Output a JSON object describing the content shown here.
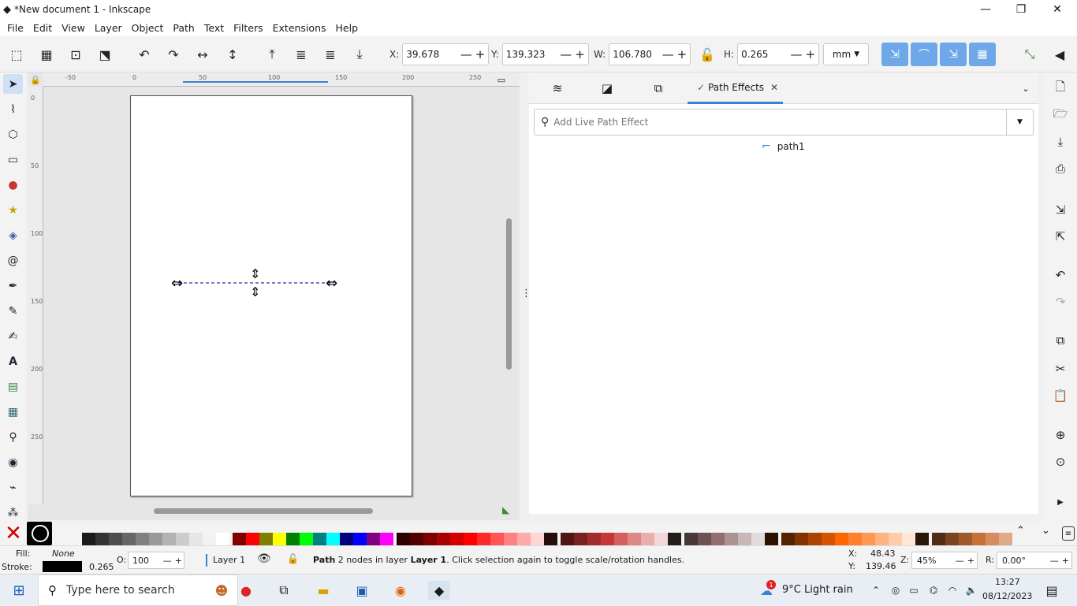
{
  "window": {
    "title": "*New document 1 - Inkscape",
    "minimize": "—",
    "maximize": "❐",
    "close": "✕"
  },
  "menu": [
    "File",
    "Edit",
    "View",
    "Layer",
    "Object",
    "Path",
    "Text",
    "Filters",
    "Extensions",
    "Help"
  ],
  "toolbar": {
    "x_label": "X:",
    "x_value": "39.678",
    "y_label": "Y:",
    "y_value": "139.323",
    "w_label": "W:",
    "w_value": "106.780",
    "h_label": "H:",
    "h_value": "0.265",
    "unit": "mm",
    "minus": "—",
    "plus": "+"
  },
  "ruler": {
    "h": [
      "-50",
      "0",
      "50",
      "100",
      "150",
      "200",
      "250"
    ],
    "v": [
      "0",
      "50",
      "100",
      "150",
      "200",
      "250"
    ]
  },
  "dialog": {
    "tab_label": "Path Effects",
    "tab_close": "✕",
    "search_placeholder": "Add Live Path Effect",
    "item": "path1"
  },
  "status": {
    "fill_label": "Fill:",
    "fill_value": "None",
    "stroke_label": "Stroke:",
    "stroke_width": "0.265",
    "opacity_label": "O:",
    "opacity_value": "100",
    "layer": "Layer 1",
    "message_bold": "Path",
    "message": " 2 nodes in layer ",
    "message_layer": "Layer 1",
    "message_tail": ". Click selection again to toggle scale/rotation handles.",
    "cx_label": "X:",
    "cx": "48.43",
    "cy_label": "Y:",
    "cy": "139.46",
    "zoom_label": "Z:",
    "zoom": "45%",
    "rot_label": "R:",
    "rot": "0.00°"
  },
  "taskbar": {
    "search_placeholder": "Type here to search",
    "weather": "9°C  Light rain",
    "time": "13:27",
    "date": "08/12/2023",
    "notif": "1"
  },
  "colors": {
    "accent": "#3b82d6",
    "snap": "#6ea8e8",
    "selection": "#2233aa"
  }
}
